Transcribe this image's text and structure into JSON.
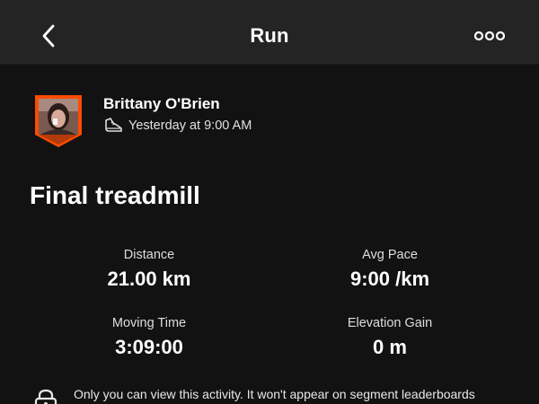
{
  "header": {
    "title": "Run",
    "back_icon": "chevron-left-icon",
    "more_icon": "more-horizontal-icon"
  },
  "athlete": {
    "name": "Brittany O'Brien",
    "activity_time": "Yesterday at 9:00 AM",
    "activity_type_icon": "running-shoe-icon",
    "avatar_frame_color": "#fc4c02"
  },
  "activity": {
    "title": "Final treadmill"
  },
  "stats": [
    {
      "label": "Distance",
      "value": "21.00 km"
    },
    {
      "label": "Avg Pace",
      "value": "9:00 /km"
    },
    {
      "label": "Moving Time",
      "value": "3:09:00"
    },
    {
      "label": "Elevation Gain",
      "value": "0 m"
    }
  ],
  "privacy": {
    "icon": "lock-icon",
    "text": "Only you can view this activity. It won't appear on segment leaderboards"
  },
  "colors": {
    "background": "#121212",
    "header_background": "#242424",
    "accent": "#fc4c02"
  }
}
